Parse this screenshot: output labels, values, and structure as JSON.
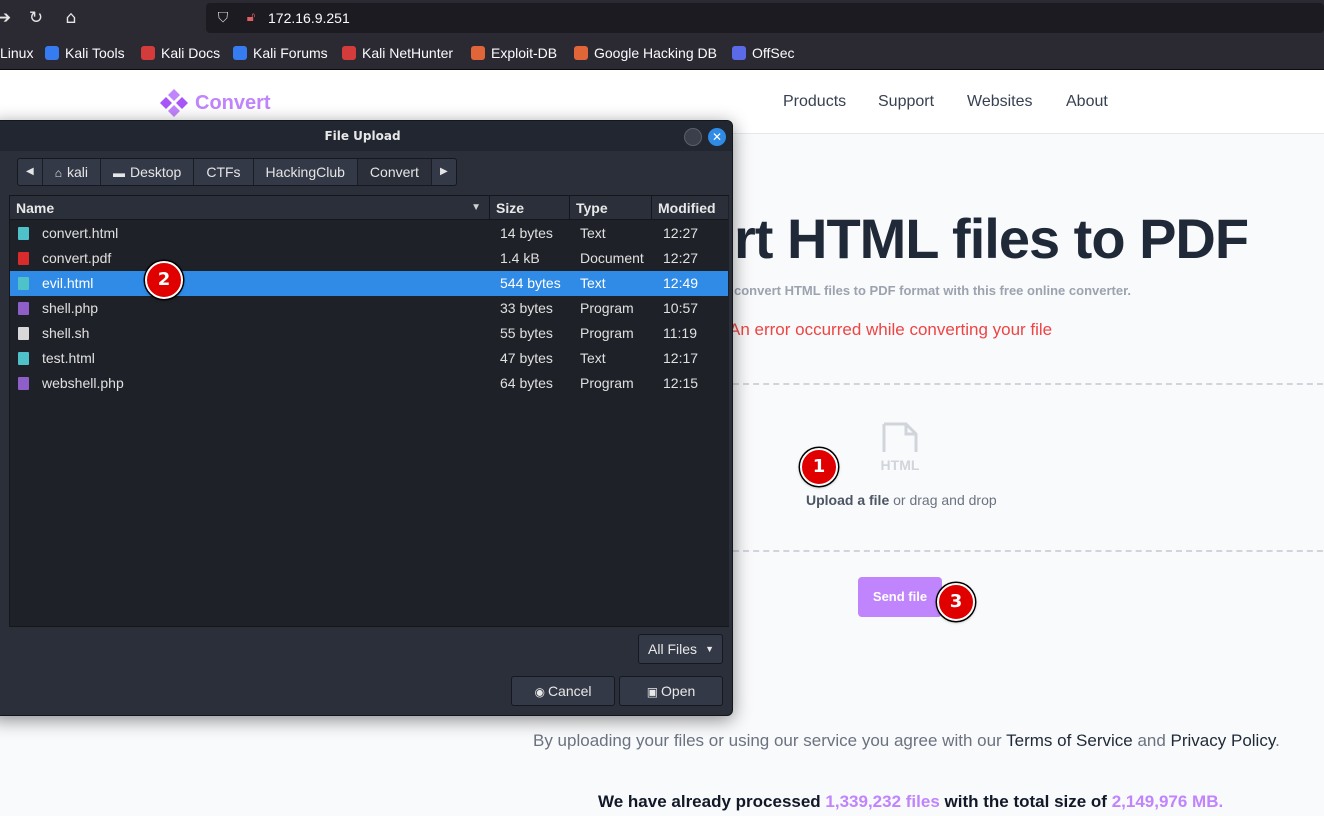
{
  "browser": {
    "url": "172.16.9.251",
    "bookmarks": [
      {
        "label": "Linux",
        "color": "#00000000"
      },
      {
        "label": "Kali Tools",
        "color": "#367bf0"
      },
      {
        "label": "Kali Docs",
        "color": "#d43b3b"
      },
      {
        "label": "Kali Forums",
        "color": "#367bf0"
      },
      {
        "label": "Kali NetHunter",
        "color": "#d43b3b"
      },
      {
        "label": "Exploit-DB",
        "color": "#e0663a"
      },
      {
        "label": "Google Hacking DB",
        "color": "#e0663a"
      },
      {
        "label": "OffSec",
        "color": "#5b6be8"
      }
    ]
  },
  "site": {
    "logo": "Convert",
    "nav": [
      "Products",
      "Support",
      "Websites",
      "About"
    ],
    "hero_title": "rt HTML files to PDF",
    "hero_subtitle": "convert HTML files to PDF format with this free online converter.",
    "error": "An error occurred while converting your file",
    "dropzone": {
      "icon_label": "HTML",
      "upload_link": "Upload a file",
      "upload_rest": " or drag and drop"
    },
    "send_button": "Send file",
    "terms": {
      "prefix": "By uploading your files or using our service you agree with our ",
      "tos": "Terms of Service",
      "and": " and ",
      "privacy": "Privacy Policy",
      "suffix": "."
    },
    "stats": {
      "prefix": "We have already processed ",
      "files": "1,339,232 files",
      "middle": " with the total size of ",
      "size": "2,149,976 MB."
    },
    "accent_color": "#c084fc",
    "error_color": "#ef4444"
  },
  "dialog": {
    "title": "File Upload",
    "path": [
      "kali",
      "Desktop",
      "CTFs",
      "HackingClub",
      "Convert"
    ],
    "columns": {
      "name": "Name",
      "size": "Size",
      "type": "Type",
      "modified": "Modified"
    },
    "files": [
      {
        "name": "convert.html",
        "size": "14 bytes",
        "type": "Text",
        "modified": "12:27",
        "icon": "text-file-icon",
        "selected": false
      },
      {
        "name": "convert.pdf",
        "size": "1.4 kB",
        "type": "Document",
        "modified": "12:27",
        "icon": "pdf-file-icon",
        "selected": false
      },
      {
        "name": "evil.html",
        "size": "544 bytes",
        "type": "Text",
        "modified": "12:49",
        "icon": "text-file-icon",
        "selected": true
      },
      {
        "name": "shell.php",
        "size": "33 bytes",
        "type": "Program",
        "modified": "10:57",
        "icon": "program-file-icon",
        "selected": false
      },
      {
        "name": "shell.sh",
        "size": "55 bytes",
        "type": "Program",
        "modified": "11:19",
        "icon": "plain-file-icon",
        "selected": false
      },
      {
        "name": "test.html",
        "size": "47 bytes",
        "type": "Text",
        "modified": "12:17",
        "icon": "text-file-icon",
        "selected": false
      },
      {
        "name": "webshell.php",
        "size": "64 bytes",
        "type": "Program",
        "modified": "12:15",
        "icon": "program-file-icon",
        "selected": false
      }
    ],
    "filter": "All Files",
    "cancel": "Cancel",
    "open": "Open",
    "selection_color": "#2f8be6"
  },
  "markers": [
    "1",
    "2",
    "3"
  ]
}
